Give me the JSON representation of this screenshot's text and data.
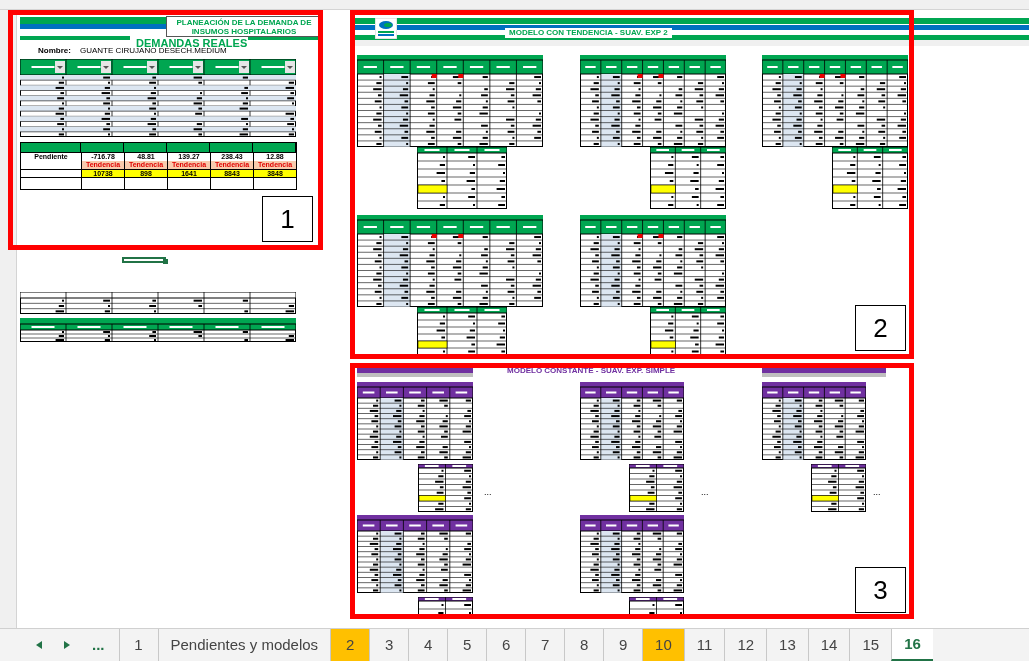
{
  "left_block": {
    "title_lines": [
      "PLANEACIÓN DE LA DEMANDA DE",
      "INSUMOS HOSPITALARIOS"
    ],
    "section_title": "DEMANDAS REALES",
    "name_label": "Nombre:",
    "name_value": "GUANTE CIRUJANO DESECH.MEDIUM",
    "summary": {
      "row_label": "Pendiente",
      "columns": [
        {
          "value": "-716.78",
          "trend": "Tendencia",
          "pending": "10738"
        },
        {
          "value": "48.81",
          "trend": "Tendencia",
          "pending": "898"
        },
        {
          "value": "139.27",
          "trend": "Tendencia",
          "pending": "1641"
        },
        {
          "value": "238.43",
          "trend": "Tendencia",
          "pending": "8843"
        },
        {
          "value": "12.88",
          "trend": "Tendencia",
          "pending": "3848"
        }
      ]
    }
  },
  "models": [
    {
      "title": "MODELO CON TENDENCIA - SUAV. EXP 2",
      "color": "#00a651"
    },
    {
      "title": "MODELO CONSTANTE - SUAV. EXP. SIMPLE",
      "color": "#7030a0",
      "ellipses": [
        "...",
        "...",
        "..."
      ]
    }
  ],
  "annotations": [
    {
      "label": "1"
    },
    {
      "label": "2"
    },
    {
      "label": "3"
    }
  ],
  "sheet_tabs": {
    "more": "...",
    "tabs": [
      {
        "label": "1",
        "selected": false
      },
      {
        "label": "Pendientes y modelos",
        "selected": false
      },
      {
        "label": "2",
        "selected": false,
        "color": "#ffc000"
      },
      {
        "label": "3",
        "selected": false
      },
      {
        "label": "4",
        "selected": false
      },
      {
        "label": "5",
        "selected": false
      },
      {
        "label": "6",
        "selected": false
      },
      {
        "label": "7",
        "selected": false
      },
      {
        "label": "8",
        "selected": false
      },
      {
        "label": "9",
        "selected": false
      },
      {
        "label": "10",
        "selected": false,
        "color": "#ffc000"
      },
      {
        "label": "11",
        "selected": false
      },
      {
        "label": "12",
        "selected": false
      },
      {
        "label": "13",
        "selected": false
      },
      {
        "label": "14",
        "selected": false
      },
      {
        "label": "15",
        "selected": false
      },
      {
        "label": "16",
        "selected": true
      }
    ]
  }
}
